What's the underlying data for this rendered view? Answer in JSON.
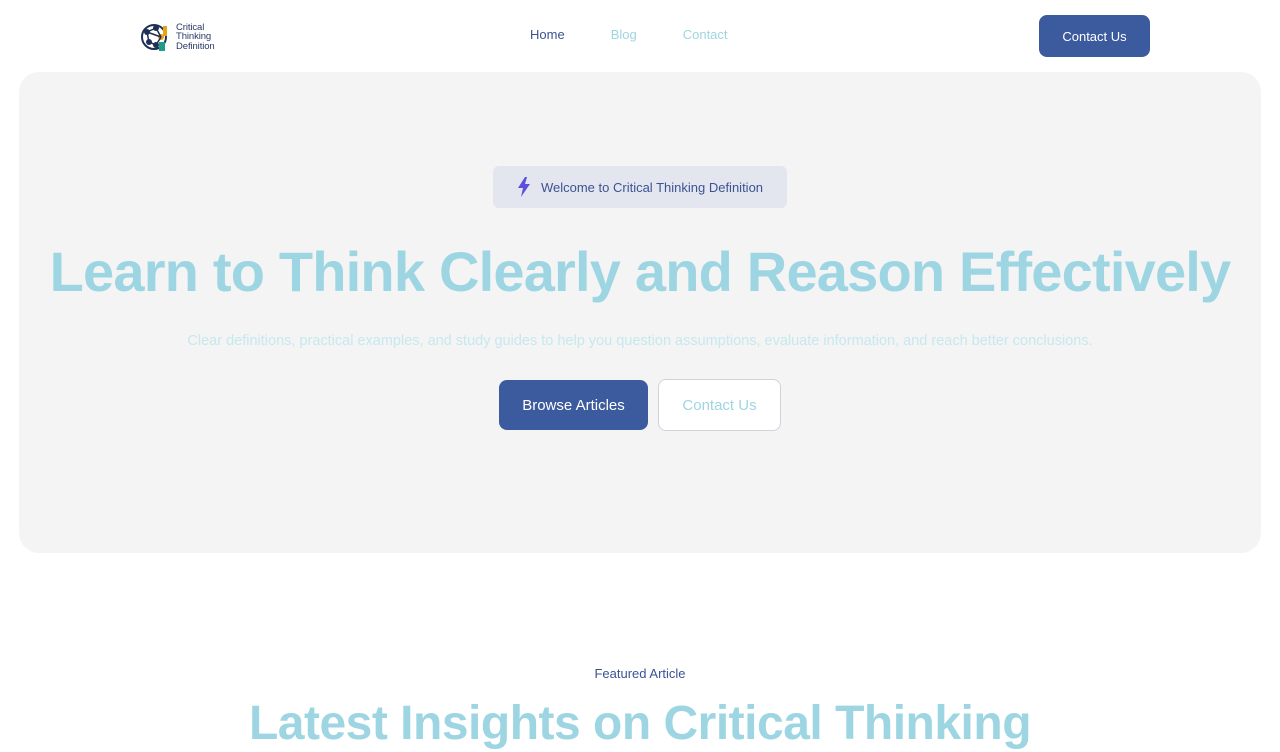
{
  "brand": {
    "logo_lines": [
      "Critical",
      "Thinking",
      "Definition"
    ]
  },
  "nav": {
    "items": [
      {
        "label": "Home"
      },
      {
        "label": "Blog"
      },
      {
        "label": "Contact"
      }
    ],
    "cta_label": "Contact Us"
  },
  "hero": {
    "badge_icon": "lightning-icon",
    "badge_text": "Welcome to Critical Thinking Definition",
    "title": "Learn to Think Clearly and Reason Effectively",
    "subtitle": "Clear definitions, practical examples, and study guides to help you question assumptions, evaluate information, and reach better conclusions.",
    "primary_button": "Browse Articles",
    "secondary_button": "Contact Us"
  },
  "featured": {
    "label": "Featured Article",
    "title": "Latest Insights on Critical Thinking"
  },
  "colors": {
    "accent": "#3c5a9e",
    "heading": "#9dd6e2",
    "hero_background": "#f4f4f4",
    "badge_icon": "#5b4fe0"
  }
}
